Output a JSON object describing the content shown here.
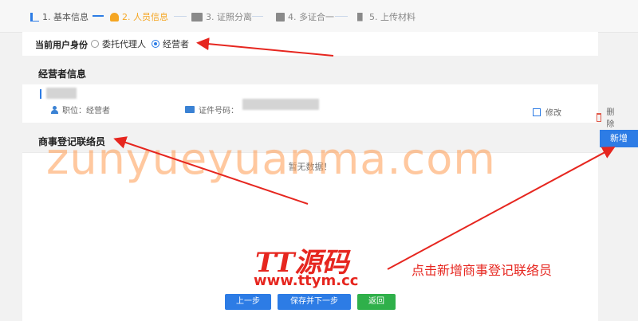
{
  "steps": [
    {
      "label": "1. 基本信息",
      "state": "done"
    },
    {
      "label": "2. 人员信息",
      "state": "active"
    },
    {
      "label": "3. 证照分离",
      "state": "todo"
    },
    {
      "label": "4. 多证合一",
      "state": "todo"
    },
    {
      "label": "5. 上传材料",
      "state": "todo"
    }
  ],
  "identity": {
    "label": "当前用户身份",
    "options": [
      "委托代理人",
      "经营者"
    ],
    "selected": "经营者"
  },
  "operator": {
    "title": "经营者信息",
    "position_label": "职位：经营者",
    "id_label": "证件号码：",
    "edit": "修改",
    "delete": "删除"
  },
  "liaison": {
    "title": "商事登记联络员",
    "add": "新增",
    "empty": "暂无数据！"
  },
  "footer": {
    "prev": "上一步",
    "save_next": "保存并下一步",
    "back": "返回"
  },
  "overlay": {
    "watermark": "zunyueyuanma.com",
    "brand": "TT源码",
    "brand_url": "www.ttym.cc",
    "hint": "点击新增商事登记联络员",
    "arrow_color": "#e6261f"
  },
  "colors": {
    "primary": "#2d7ce5",
    "active_step": "#f5a623",
    "success": "#2fb04a"
  }
}
